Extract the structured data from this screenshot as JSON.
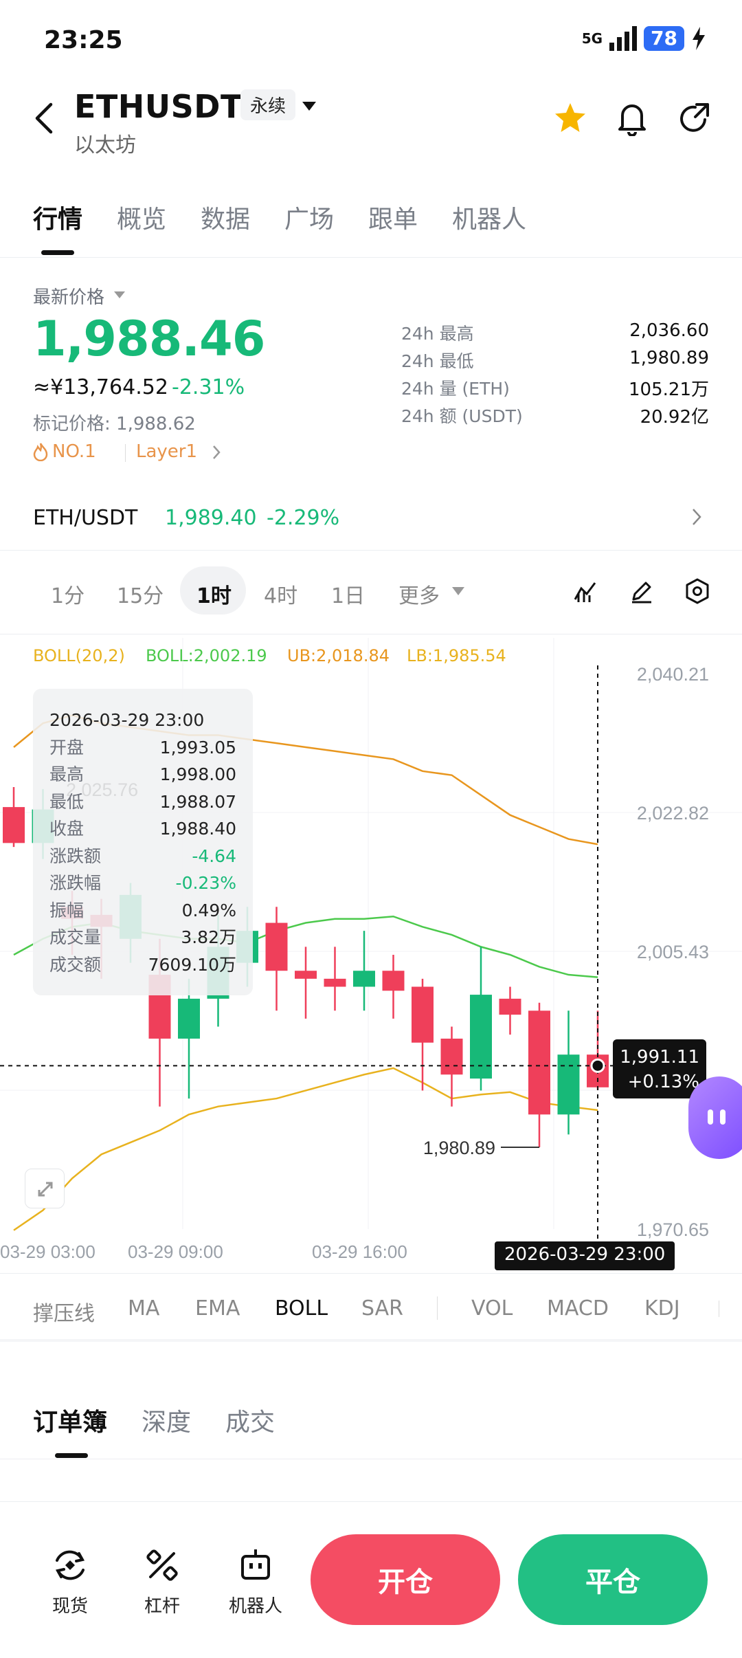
{
  "status_bar": {
    "time": "23:25",
    "network": "5G",
    "battery": "78"
  },
  "header": {
    "pair": "ETHUSDT",
    "type_badge": "永续",
    "subtitle": "以太坊"
  },
  "main_tabs": [
    {
      "label": "行情"
    },
    {
      "label": "概览"
    },
    {
      "label": "数据"
    },
    {
      "label": "广场"
    },
    {
      "label": "跟单"
    },
    {
      "label": "机器人"
    }
  ],
  "price": {
    "latest_label": "最新价格",
    "last": "1,988.46",
    "cny": "≈¥13,764.52",
    "change_pct": "-2.31%",
    "mark": "标记价格: 1,988.62",
    "rank": "NO.1",
    "tag": "Layer1",
    "stats": [
      {
        "label": "24h  最高",
        "value": "2,036.60"
      },
      {
        "label": "24h  最低",
        "value": "1,980.89"
      },
      {
        "label": "24h  量 (ETH)",
        "value": "105.21万"
      },
      {
        "label": "24h  额 (USDT)",
        "value": "20.92亿"
      }
    ]
  },
  "spot": {
    "pair": "ETH/USDT",
    "price": "1,989.40",
    "change": "-2.29%"
  },
  "intervals": [
    "1分",
    "15分",
    "1时",
    "4时",
    "1日",
    "更多"
  ],
  "boll_legend": {
    "name": "BOLL(20,2)",
    "mid": "BOLL:2,002.19",
    "ub": "UB:2,018.84",
    "lb": "LB:1,985.54",
    "color_name": "#e8b21e",
    "color_mid": "#4cc94c",
    "color_ub": "#e8961e",
    "color_lb": "#e8b21e"
  },
  "tooltip": {
    "datetime": "2026-03-29 23:00",
    "rows": [
      {
        "k": "开盘",
        "v": "1,993.05"
      },
      {
        "k": "最高",
        "v": "1,998.00"
      },
      {
        "k": "最低",
        "v": "1,988.07"
      },
      {
        "k": "收盘",
        "v": "1,988.40"
      },
      {
        "k": "涨跌额",
        "v": "-4.64"
      },
      {
        "k": "涨跌幅",
        "v": "-0.23%"
      },
      {
        "k": "振幅",
        "v": "0.49%"
      },
      {
        "k": "成交量",
        "v": "3.82万"
      },
      {
        "k": "成交额",
        "v": "7609.10万"
      }
    ]
  },
  "chart_data": {
    "type": "candlestick",
    "y_ticks": [
      "2,040.21",
      "2,022.82",
      "2,005.43",
      "1,970.65"
    ],
    "x_ticks": [
      "03-29 03:00",
      "03-29 09:00",
      "03-29 16:00"
    ],
    "ylim": [
      1970.65,
      2040.21
    ],
    "annotations": {
      "high_label": "2,025.76",
      "low_label": "1,980.89"
    },
    "cursor": {
      "price": "1,991.11",
      "pct": "+0.13%",
      "time": "2026-03-29 23:00"
    },
    "candles": [
      {
        "o": 2023.5,
        "c": 2019.0,
        "h": 2026.0,
        "l": 2018.5
      },
      {
        "o": 2019.0,
        "c": 2023.2,
        "h": 2025.76,
        "l": 2017.0
      },
      {
        "o": 2011.0,
        "c": 2009.5,
        "h": 2013.0,
        "l": 2005.0
      },
      {
        "o": 2010.0,
        "c": 2008.5,
        "h": 2012.0,
        "l": 2002.0
      },
      {
        "o": 2007.0,
        "c": 2012.5,
        "h": 2014.0,
        "l": 2004.0
      },
      {
        "o": 2002.5,
        "c": 1994.5,
        "h": 2007.0,
        "l": 1986.0
      },
      {
        "o": 1994.5,
        "c": 1999.5,
        "h": 2002.0,
        "l": 1987.0
      },
      {
        "o": 1999.5,
        "c": 2006.0,
        "h": 2010.0,
        "l": 1996.0
      },
      {
        "o": 2004.0,
        "c": 2008.0,
        "h": 2011.0,
        "l": 2001.0
      },
      {
        "o": 2009.0,
        "c": 2003.0,
        "h": 2011.0,
        "l": 1998.0
      },
      {
        "o": 2003.0,
        "c": 2002.0,
        "h": 2006.0,
        "l": 1997.0
      },
      {
        "o": 2002.0,
        "c": 2001.0,
        "h": 2006.0,
        "l": 1998.0
      },
      {
        "o": 2001.0,
        "c": 2003.0,
        "h": 2008.0,
        "l": 1998.0
      },
      {
        "o": 2003.0,
        "c": 2000.5,
        "h": 2005.0,
        "l": 1997.0
      },
      {
        "o": 2001.0,
        "c": 1994.0,
        "h": 2002.0,
        "l": 1988.0
      },
      {
        "o": 1994.5,
        "c": 1990.0,
        "h": 1996.0,
        "l": 1986.0
      },
      {
        "o": 1989.5,
        "c": 2000.0,
        "h": 2006.0,
        "l": 1988.0
      },
      {
        "o": 1999.5,
        "c": 1997.5,
        "h": 2001.0,
        "l": 1995.0
      },
      {
        "o": 1998.0,
        "c": 1985.0,
        "h": 1999.0,
        "l": 1980.89
      },
      {
        "o": 1985.0,
        "c": 1992.5,
        "h": 1998.0,
        "l": 1982.5
      },
      {
        "o": 1992.5,
        "c": 1988.4,
        "h": 1998.0,
        "l": 1988.07
      }
    ],
    "boll_ub": [
      2031.0,
      2034.0,
      2035.0,
      2034.0,
      2033.5,
      2033.0,
      2032.5,
      2032.5,
      2032.0,
      2031.5,
      2031.0,
      2030.5,
      2030.0,
      2029.5,
      2028.0,
      2027.5,
      2025.0,
      2022.5,
      2021.0,
      2019.5,
      2018.84
    ],
    "boll_mid": [
      2005.0,
      2007.0,
      2008.5,
      2009.0,
      2008.0,
      2007.5,
      2007.0,
      2007.0,
      2006.5,
      2008.0,
      2009.0,
      2009.5,
      2009.5,
      2009.8,
      2008.5,
      2007.5,
      2006.0,
      2005.0,
      2003.5,
      2002.5,
      2002.19
    ],
    "boll_lb": [
      1970.5,
      1973.0,
      1977.0,
      1980.0,
      1981.5,
      1983.0,
      1985.0,
      1986.0,
      1986.5,
      1987.0,
      1988.0,
      1989.0,
      1990.0,
      1990.8,
      1989.0,
      1987.0,
      1987.5,
      1987.8,
      1986.5,
      1986.0,
      1985.54
    ]
  },
  "indicators": [
    "撑压线",
    "MA",
    "EMA",
    "BOLL",
    "SAR",
    "VOL",
    "MACD",
    "KDJ"
  ],
  "book_tabs": [
    "订单簿",
    "深度",
    "成交"
  ],
  "bottom_nav": [
    {
      "label": "现货"
    },
    {
      "label": "杠杆"
    },
    {
      "label": "机器人"
    }
  ],
  "actions": {
    "open": "开仓",
    "close": "平仓"
  },
  "colors": {
    "up": "#17b978",
    "down": "#ef3f5a",
    "open_btn": "#f44d63",
    "close_btn": "#22c084"
  }
}
